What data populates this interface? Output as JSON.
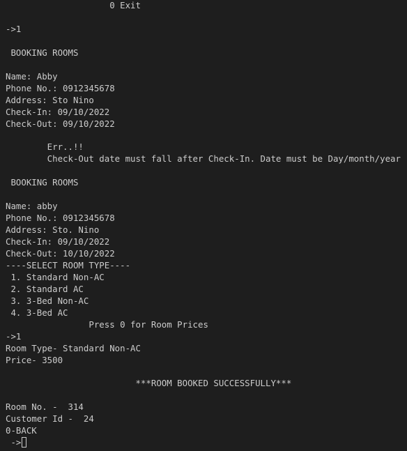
{
  "terminal": {
    "lines": [
      "                    0 Exit",
      "",
      "->1",
      "",
      " BOOKING ROOMS",
      "",
      "Name: Abby",
      "Phone No.: 0912345678",
      "Address: Sto Nino",
      "Check-In: 09/10/2022",
      "Check-Out: 09/10/2022",
      "",
      "        Err..!!",
      "        Check-Out date must fall after Check-In. Date must be Day/month/year",
      "",
      " BOOKING ROOMS",
      "",
      "Name: abby",
      "Phone No.: 0912345678",
      "Address: Sto. Nino",
      "Check-In: 09/10/2022",
      "Check-Out: 10/10/2022",
      "----SELECT ROOM TYPE----",
      " 1. Standard Non-AC",
      " 2. Standard AC",
      " 3. 3-Bed Non-AC",
      " 4. 3-Bed AC",
      "                Press 0 for Room Prices",
      "->1",
      "Room Type- Standard Non-AC",
      "Price- 3500",
      "",
      "                         ***ROOM BOOKED SUCCESSFULLY***",
      "",
      "Room No. -  314",
      "Customer Id -  24",
      "0-BACK"
    ],
    "prompt": " ->"
  }
}
